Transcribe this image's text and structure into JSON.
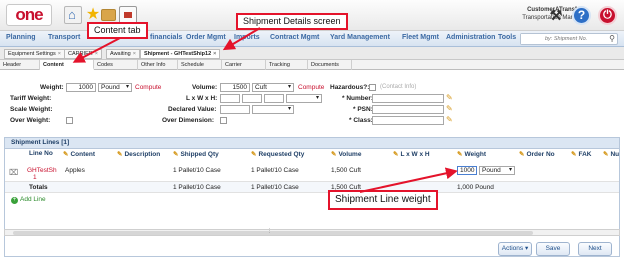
{
  "topbar": {
    "logo_text": "one",
    "user_name": "CustomerATransMgr",
    "user_role": "Transportation Manager"
  },
  "mainnav": {
    "items": [
      "Planning",
      "Transport",
      "financials",
      "Order Mgmt",
      "Imports",
      "Contract Mgmt",
      "Yard Management",
      "Fleet Mgmt",
      "Administration",
      "Tools"
    ],
    "search_placeholder": "by: Shipment No."
  },
  "crumbs": {
    "items": [
      "Equipment Settings",
      "CARRIER",
      "Awaiting",
      "Shipment - GHTestShip12"
    ]
  },
  "subtabs": [
    "Header",
    "Content",
    "Codes",
    "Other Info",
    "Schedule",
    "Carrier",
    "Tracking",
    "Documents"
  ],
  "form": {
    "weight_label": "Weight:",
    "weight_value": "1000",
    "weight_uom": "Pound",
    "compute_label": "Compute",
    "volume_label": "Volume:",
    "volume_value": "1500",
    "volume_uom": "Cuft",
    "tariff_weight_label": "Tariff Weight:",
    "lwh_label": "L x W x H:",
    "scale_weight_label": "Scale Weight:",
    "declared_value_label": "Declared Value:",
    "over_weight_label": "Over Weight:",
    "over_dimension_label": "Over Dimension:",
    "hazardous_label": "Hazardous?:",
    "contact_info_label": "(Contact Info)",
    "number_label": "* Number:",
    "psn_label": "* PSN:",
    "class_label": "* Class:"
  },
  "lines": {
    "title": "Shipment Lines [1]",
    "columns": [
      "Line No",
      "Content",
      "Description",
      "Shipped Qty",
      "Requested Qty",
      "Volume",
      "L x W x H",
      "Weight",
      "Order No",
      "FAK",
      "Nu"
    ],
    "row": {
      "line_no": "GHTestSh",
      "line_no_2": "1",
      "content": "Apples",
      "shipped_qty": "1 Pallet/10 Case",
      "requested_qty": "1 Pallet/10 Case",
      "volume": "1,500 Cuft",
      "weight_value": "1000",
      "weight_uom": "Pound"
    },
    "totals": {
      "label": "Totals",
      "shipped_qty": "1 Pallet/10 Case",
      "requested_qty": "1 Pallet/10 Case",
      "volume": "1,500 Cuft",
      "weight": "1,000 Pound"
    },
    "add_line": "Add Line"
  },
  "footer": {
    "actions_label": "Actions",
    "save_label": "Save",
    "next_label": "Next"
  },
  "callouts": {
    "content_tab": "Content tab",
    "shipment_details": "Shipment Details screen",
    "line_weight": "Shipment Line weight"
  },
  "colors": {
    "accent_red": "#e4132b",
    "brand_red": "#c8102e",
    "nav_blue": "#3b69a3"
  }
}
